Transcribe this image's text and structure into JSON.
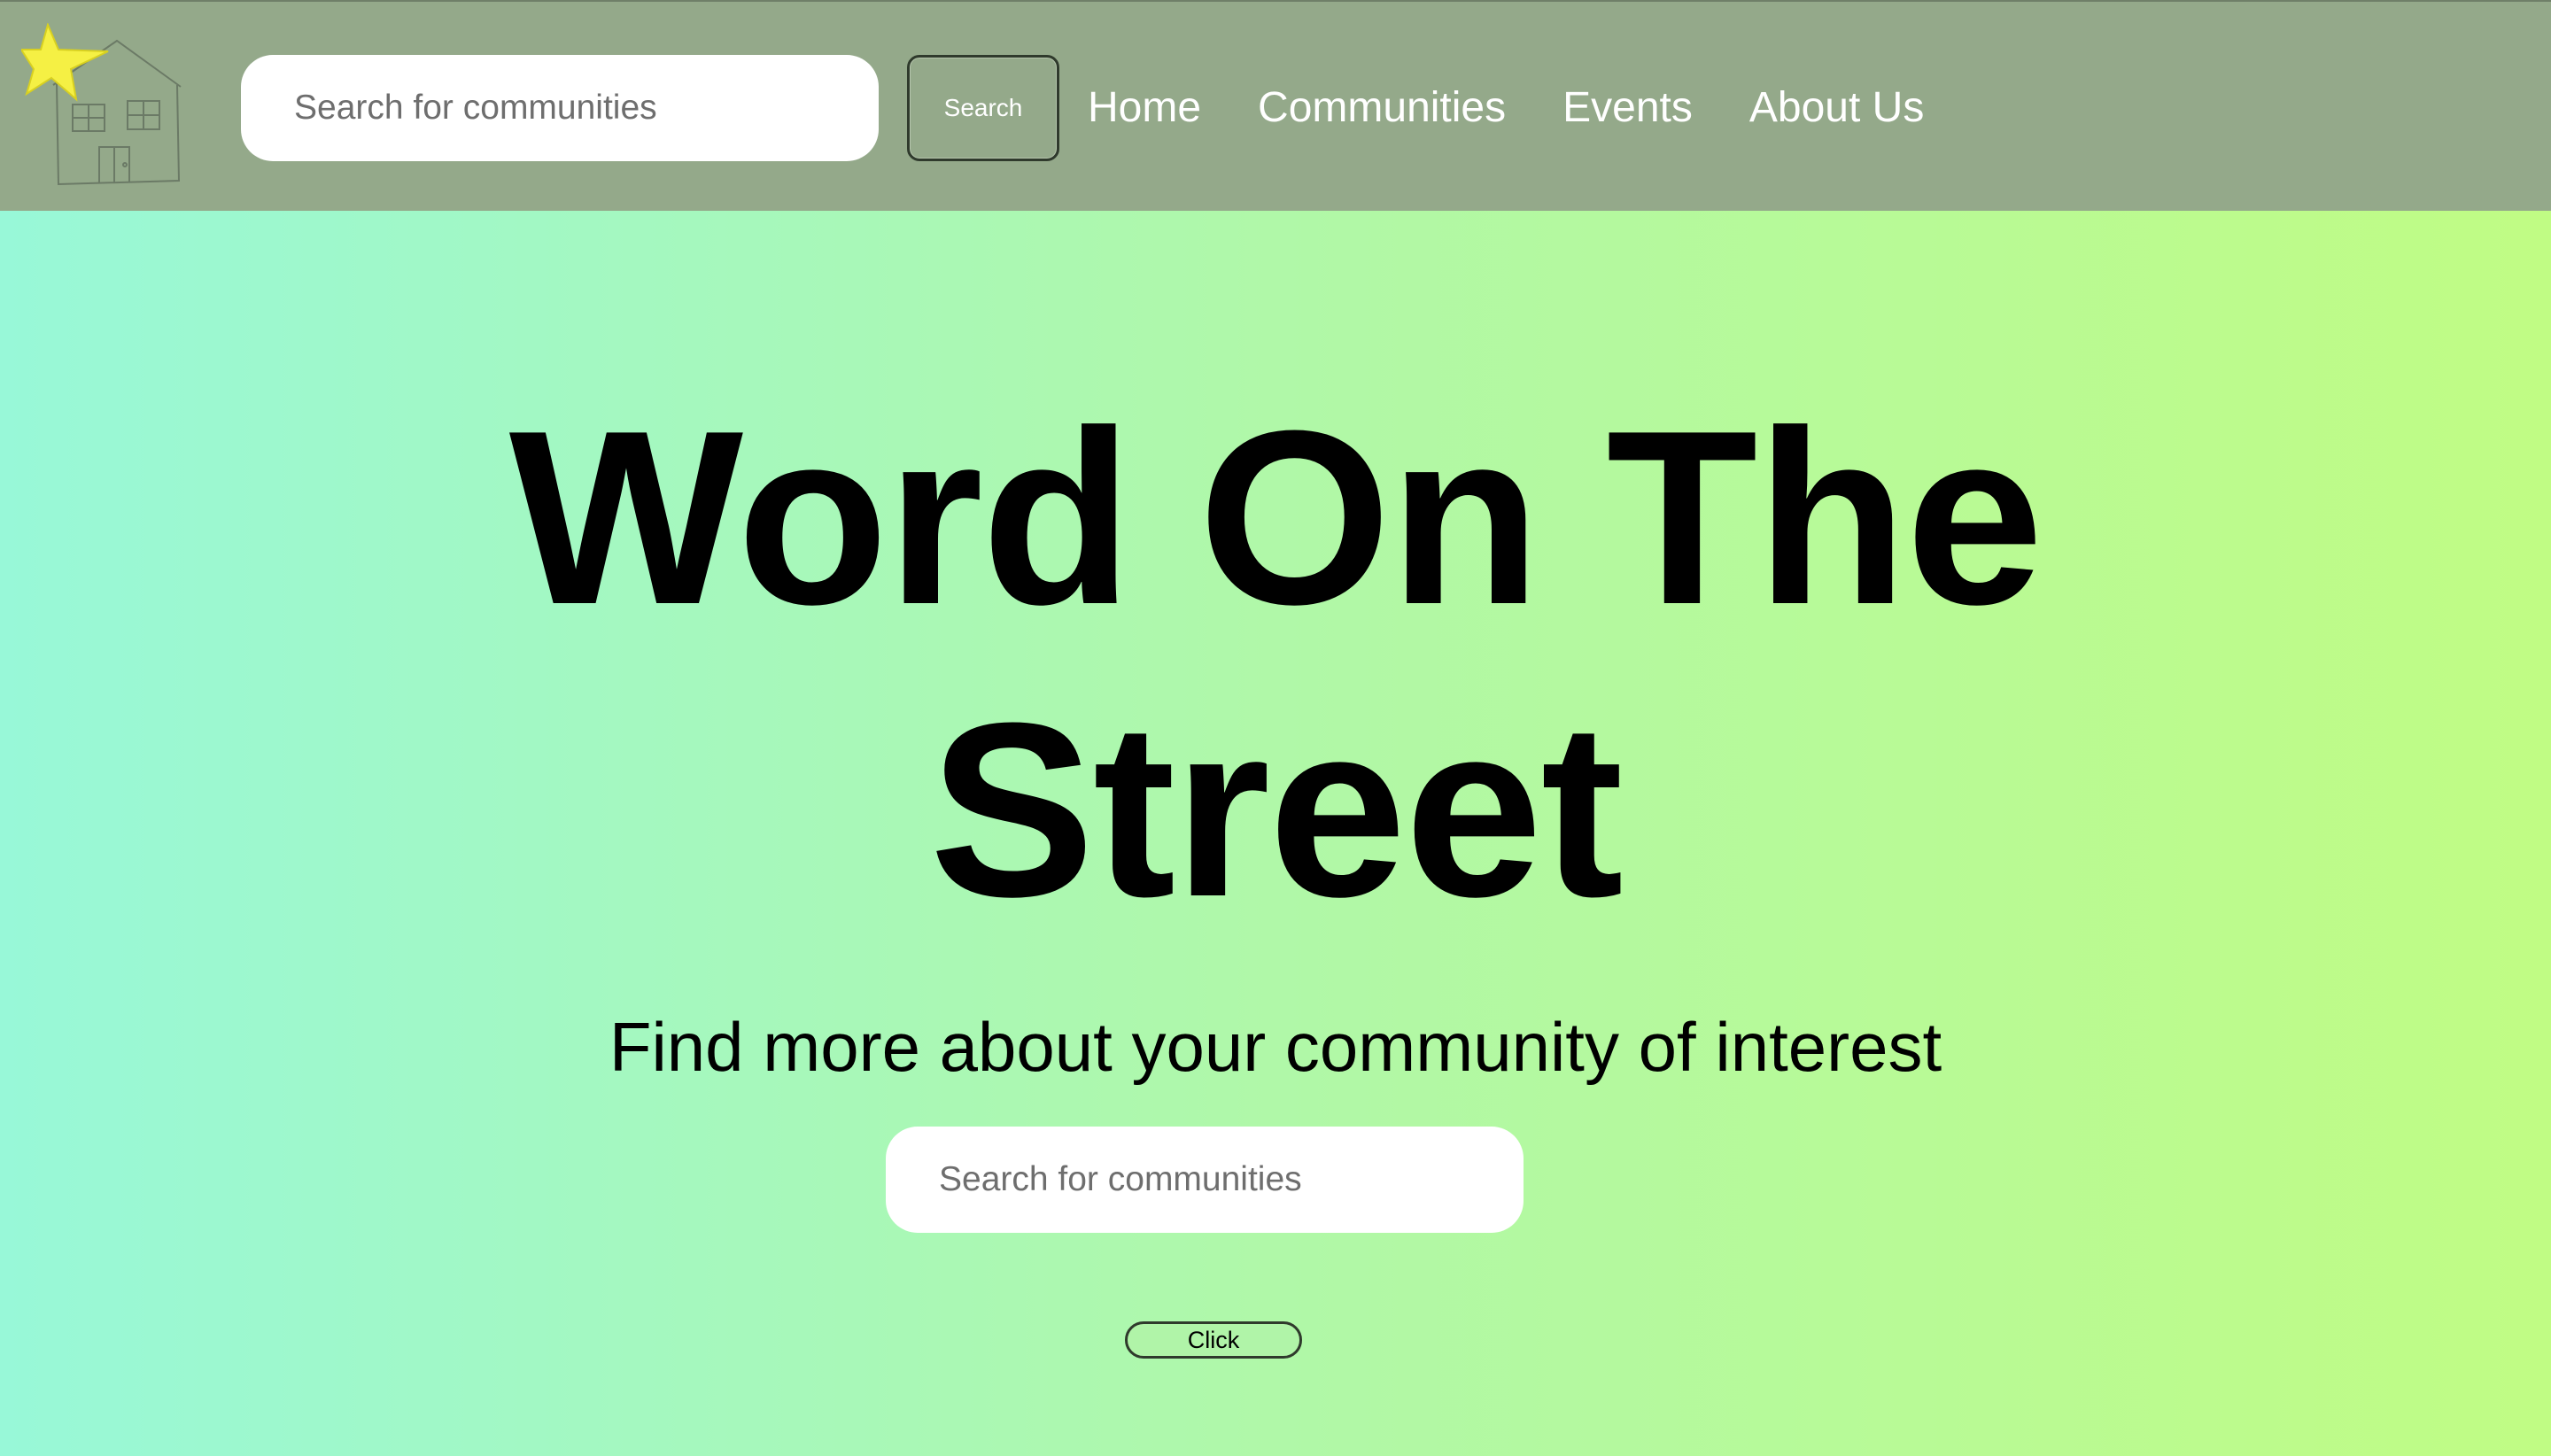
{
  "header": {
    "logo_icon": "house-with-star-logo-icon",
    "search": {
      "placeholder": "Search for communities",
      "value": ""
    },
    "search_button_label": "Search",
    "nav": [
      {
        "label": "Home"
      },
      {
        "label": "Communities"
      },
      {
        "label": "Events"
      },
      {
        "label": "About Us"
      }
    ]
  },
  "hero": {
    "title_line1": "Word On The",
    "title_line2": "Street",
    "subtitle": "Find more about your community of interest",
    "search": {
      "placeholder": "Search for communities",
      "value": ""
    },
    "button_label": "Click"
  },
  "colors": {
    "header_bg": "#94a98a",
    "gradient_start": "#98f8d8",
    "gradient_end": "#c0fc84",
    "star": "#f5f044"
  }
}
